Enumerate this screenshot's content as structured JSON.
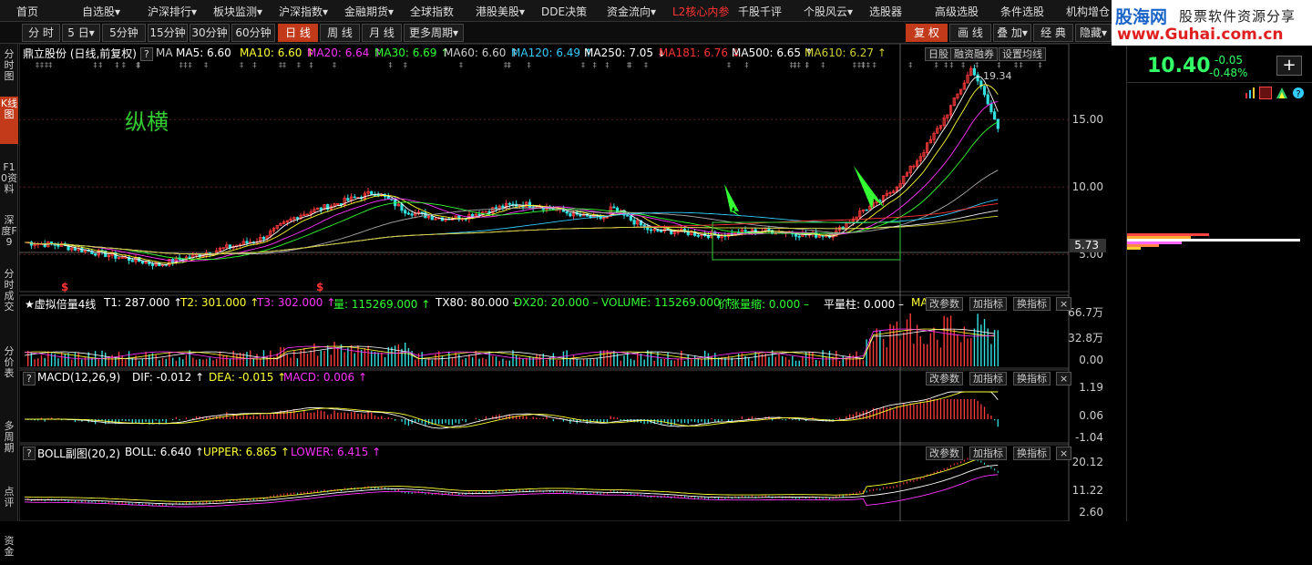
{
  "menu": {
    "items": [
      "首页",
      "自选股▾",
      "沪深排行▾",
      "板块监测▾",
      "沪深指数▾",
      "金融期货▾",
      "全球指数",
      "港股美股▾",
      "DDE决策",
      "资金流向▾",
      "L2核心内参",
      "千股千评",
      "个股风云▾",
      "选股器",
      "高级选股",
      "条件选股",
      "机构增仓"
    ],
    "highlight_index": 10
  },
  "logo": {
    "line1": "股海网",
    "line2": "股票软件资源分享",
    "url": "www.Guhai.com.cn"
  },
  "toolbar": {
    "periods": [
      "分 时",
      "5 日▾",
      "5分钟",
      "15分钟",
      "30分钟",
      "60分钟",
      "日 线",
      "周 线",
      "月 线",
      "更多周期▾"
    ],
    "active_index": 6,
    "right_buttons": [
      "复 权",
      "画 线",
      "叠 加▾",
      "经 典",
      "隐藏▾"
    ],
    "right_active_index": 0
  },
  "left_tabs": [
    "分时图",
    "K线图",
    "F10资料",
    "深度F9",
    "分时成交",
    "分价表",
    "多周期",
    "点评",
    "资金"
  ],
  "left_active_index": 1,
  "main_chart": {
    "legend_name": "鼎立股份 (日线,前复权)",
    "legend_items": [
      {
        "label": "MA",
        "color": "#cccccc"
      },
      {
        "label": "MA5: 6.60",
        "color": "#ffffff"
      },
      {
        "label": "MA10: 6.60 ↑",
        "color": "#ffff33"
      },
      {
        "label": "MA20: 6.64 ↑",
        "color": "#ff33ff"
      },
      {
        "label": "MA30: 6.69 ↑",
        "color": "#33ff33"
      },
      {
        "label": "MA60: 6.60 ↑",
        "color": "#cccccc"
      },
      {
        "label": "MA120: 6.49 ↑",
        "color": "#33ccff"
      },
      {
        "label": "MA250: 7.05 ↓",
        "color": "#ffffff"
      },
      {
        "label": "MA181: 6.76 ↓",
        "color": "#ff3333"
      },
      {
        "label": "MA500: 6.65 ↑",
        "color": "#ffffff"
      },
      {
        "label": "MA610: 6.27 ↑",
        "color": "#cccc33"
      }
    ],
    "buttons": [
      "日股",
      "融资融券",
      "设置均线"
    ],
    "annotation": "纵横",
    "high_label": "19.34",
    "y_ticks": [
      "15.00",
      "10.00",
      "5.00"
    ],
    "current_price_tag": "5.73",
    "dividend_marks": [
      "$",
      "$"
    ]
  },
  "volume_panel": {
    "title": "★虚拟倍量4线",
    "items": [
      {
        "label": "T1: 287.000 ↑",
        "color": "#ffffff"
      },
      {
        "label": "T2: 301.000 ↑",
        "color": "#ffff33"
      },
      {
        "label": "T3: 302.000 ↑",
        "color": "#ff33ff"
      },
      {
        "label": "量: 115269.000 ↑",
        "color": "#33ff33"
      },
      {
        "label": "TX80: 80.000 –",
        "color": "#ffffff"
      },
      {
        "label": "DX20: 20.000 –",
        "color": "#33ff33"
      },
      {
        "label": "VOLUME: 115269.000 ↑",
        "color": "#33ff33"
      },
      {
        "label": "价涨量缩: 0.000 –",
        "color": "#33ff33"
      },
      {
        "label": "平量柱: 0.000 –",
        "color": "#ffffff"
      },
      {
        "label": "MAVOL",
        "color": "#ffff33"
      }
    ],
    "y_ticks": [
      "66.7万",
      "32.8万",
      "0.00"
    ]
  },
  "macd_panel": {
    "title": "MACD(12,26,9)",
    "items": [
      {
        "label": "DIF: -0.012 ↑",
        "color": "#ffffff"
      },
      {
        "label": "DEA: -0.015 ↑",
        "color": "#ffff33"
      },
      {
        "label": "MACD: 0.006 ↑",
        "color": "#ff33ff"
      }
    ],
    "y_ticks": [
      "1.19",
      "0.06",
      "-1.04"
    ]
  },
  "boll_panel": {
    "title": "BOLL副图(20,2)",
    "items": [
      {
        "label": "BOLL: 6.640 ↑",
        "color": "#ffffff"
      },
      {
        "label": "UPPER: 6.865 ↑",
        "color": "#ffff33"
      },
      {
        "label": "LOWER: 6.415 ↑",
        "color": "#ff33ff"
      }
    ],
    "y_ticks": [
      "20.12",
      "11.22",
      "2.60"
    ]
  },
  "panel_buttons": [
    "改参数",
    "加指标",
    "换指标",
    "×"
  ],
  "question_mark": "?",
  "right_panel": {
    "price": "10.40",
    "change": "-0.05",
    "change_pct": "-0.48%",
    "plus": "+"
  }
}
